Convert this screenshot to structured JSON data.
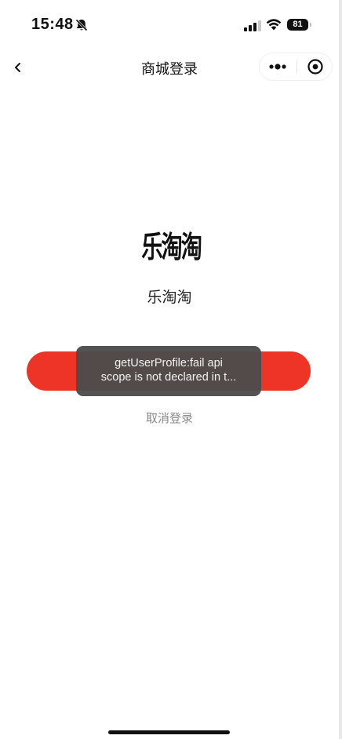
{
  "status_bar": {
    "time": "15:48",
    "battery": "81",
    "icons": [
      "bell-slash-icon",
      "signal-icon",
      "wifi-icon",
      "battery-icon"
    ]
  },
  "nav": {
    "title": "商城登录",
    "back_icon": "chevron-left-icon",
    "more_icon": "more-dots-icon",
    "close_icon": "target-circle-icon"
  },
  "content": {
    "logo_text": "乐淘淘",
    "app_name": "乐淘淘",
    "login_button_label": "",
    "cancel_label": "取消登录",
    "accent_color": "#ee3426"
  },
  "toast": {
    "line1": "getUserProfile:fail api",
    "line2": "scope is not declared in t..."
  }
}
